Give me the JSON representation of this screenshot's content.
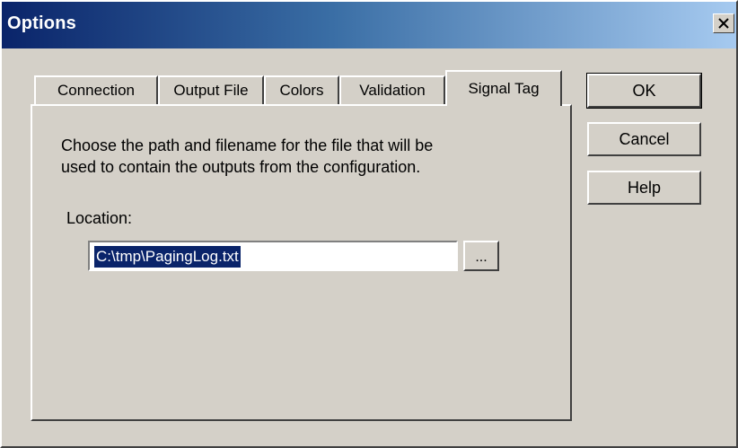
{
  "window": {
    "title": "Options",
    "close_symbol": "×"
  },
  "tabs": [
    {
      "label": "Connection",
      "active": false
    },
    {
      "label": "Output File",
      "active": false
    },
    {
      "label": "Colors",
      "active": false
    },
    {
      "label": "Validation",
      "active": false
    },
    {
      "label": "Signal Tag",
      "active": true
    }
  ],
  "panel": {
    "description_line1": "Choose the path and filename for the file that will be",
    "description_line2": "used to contain the outputs from the configuration.",
    "location_label": "Location:",
    "location_value": "C:\\tmp\\PagingLog.txt",
    "browse_label": "..."
  },
  "buttons": {
    "ok": "OK",
    "cancel": "Cancel",
    "help": "Help"
  },
  "colors": {
    "title_start": "#0a246a",
    "title_end": "#a6caf0",
    "face": "#d4d0c8",
    "selection": "#0a246a"
  }
}
